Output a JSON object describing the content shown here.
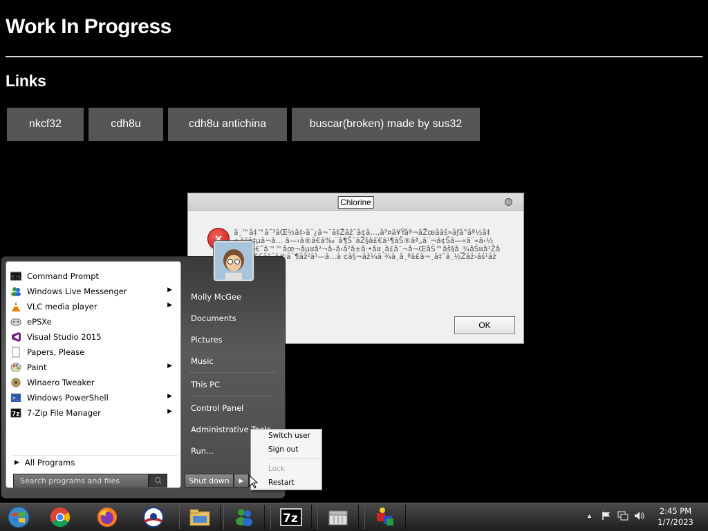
{
  "page": {
    "title": "Work In Progress",
    "section_title": "Links",
    "links": [
      "nkcf32",
      "cdh8u",
      "cdh8u antichina",
      "buscar(broken) made by sus32"
    ]
  },
  "dialog": {
    "title": "Chlorine",
    "message": "â¸™â‡™â˜³âŒ½â‡›â˜¿â¬¯â‡Žâž¨â¢â…‚â³¤â¥Ÿâª¬âŽœââš»âƒâ°âª½â‡±â°â‡µâ¬â… â—›â®â€â‰¨â¶Š¯â­Ž§â£€â¹¶âŠ®âª„â¨¬â¢Šâ—«â¨«â‹½â«¬ â€˜â™™âœ¬âµ¤â²¬â–â‹â²â±â·•â¤¸â£â¯¬â¬ŒâŠ™âš§â¸¾â­Š¤â¹Žâ˜µâ©€£â°¯â®â¨¶âž²â¹—â…à ¢â§¬âž¼â ¾â¸â¸ªâ£â¬¸â‡˜â¸½Žâž›âš¹âžŽ!ƒŽ",
    "ok_label": "OK",
    "colors": {
      "error_icon": "#d42020"
    }
  },
  "start_menu": {
    "programs": [
      {
        "label": "Command Prompt",
        "icon": "cmd-icon",
        "arrow": false
      },
      {
        "label": "Windows Live Messenger",
        "icon": "messenger-icon",
        "arrow": true
      },
      {
        "label": "VLC media player",
        "icon": "vlc-icon",
        "arrow": true
      },
      {
        "label": "ePSXe",
        "icon": "gamepad-icon",
        "arrow": false
      },
      {
        "label": "Visual Studio 2015",
        "icon": "visual-studio-icon",
        "arrow": false
      },
      {
        "label": "Papers, Please",
        "icon": "document-icon",
        "arrow": false
      },
      {
        "label": "Paint",
        "icon": "paint-icon",
        "arrow": true
      },
      {
        "label": "Winaero Tweaker",
        "icon": "tweaker-icon",
        "arrow": false
      },
      {
        "label": "Windows PowerShell",
        "icon": "powershell-icon",
        "arrow": true
      },
      {
        "label": "7-Zip File Manager",
        "icon": "7zip-icon",
        "arrow": true
      }
    ],
    "all_programs": "All Programs",
    "search_placeholder": "Search programs and files",
    "right_items": [
      "Molly McGee",
      "Documents",
      "Pictures",
      "Music",
      "This PC",
      "Control Panel",
      "Administrative Tools",
      "Run..."
    ],
    "shutdown_label": "Shut down",
    "power_menu": [
      "Switch user",
      "Sign out",
      "Lock",
      "Restart"
    ]
  },
  "taskbar": {
    "apps": [
      "start-orb-icon",
      "chrome-icon",
      "firefox-icon",
      "obama-logo-icon",
      "file-explorer-icon",
      "messenger-icon",
      "7zip-icon",
      "archive-icon",
      "tool-icon"
    ],
    "clock_time": "2:45 PM",
    "clock_date": "1/7/2023"
  }
}
